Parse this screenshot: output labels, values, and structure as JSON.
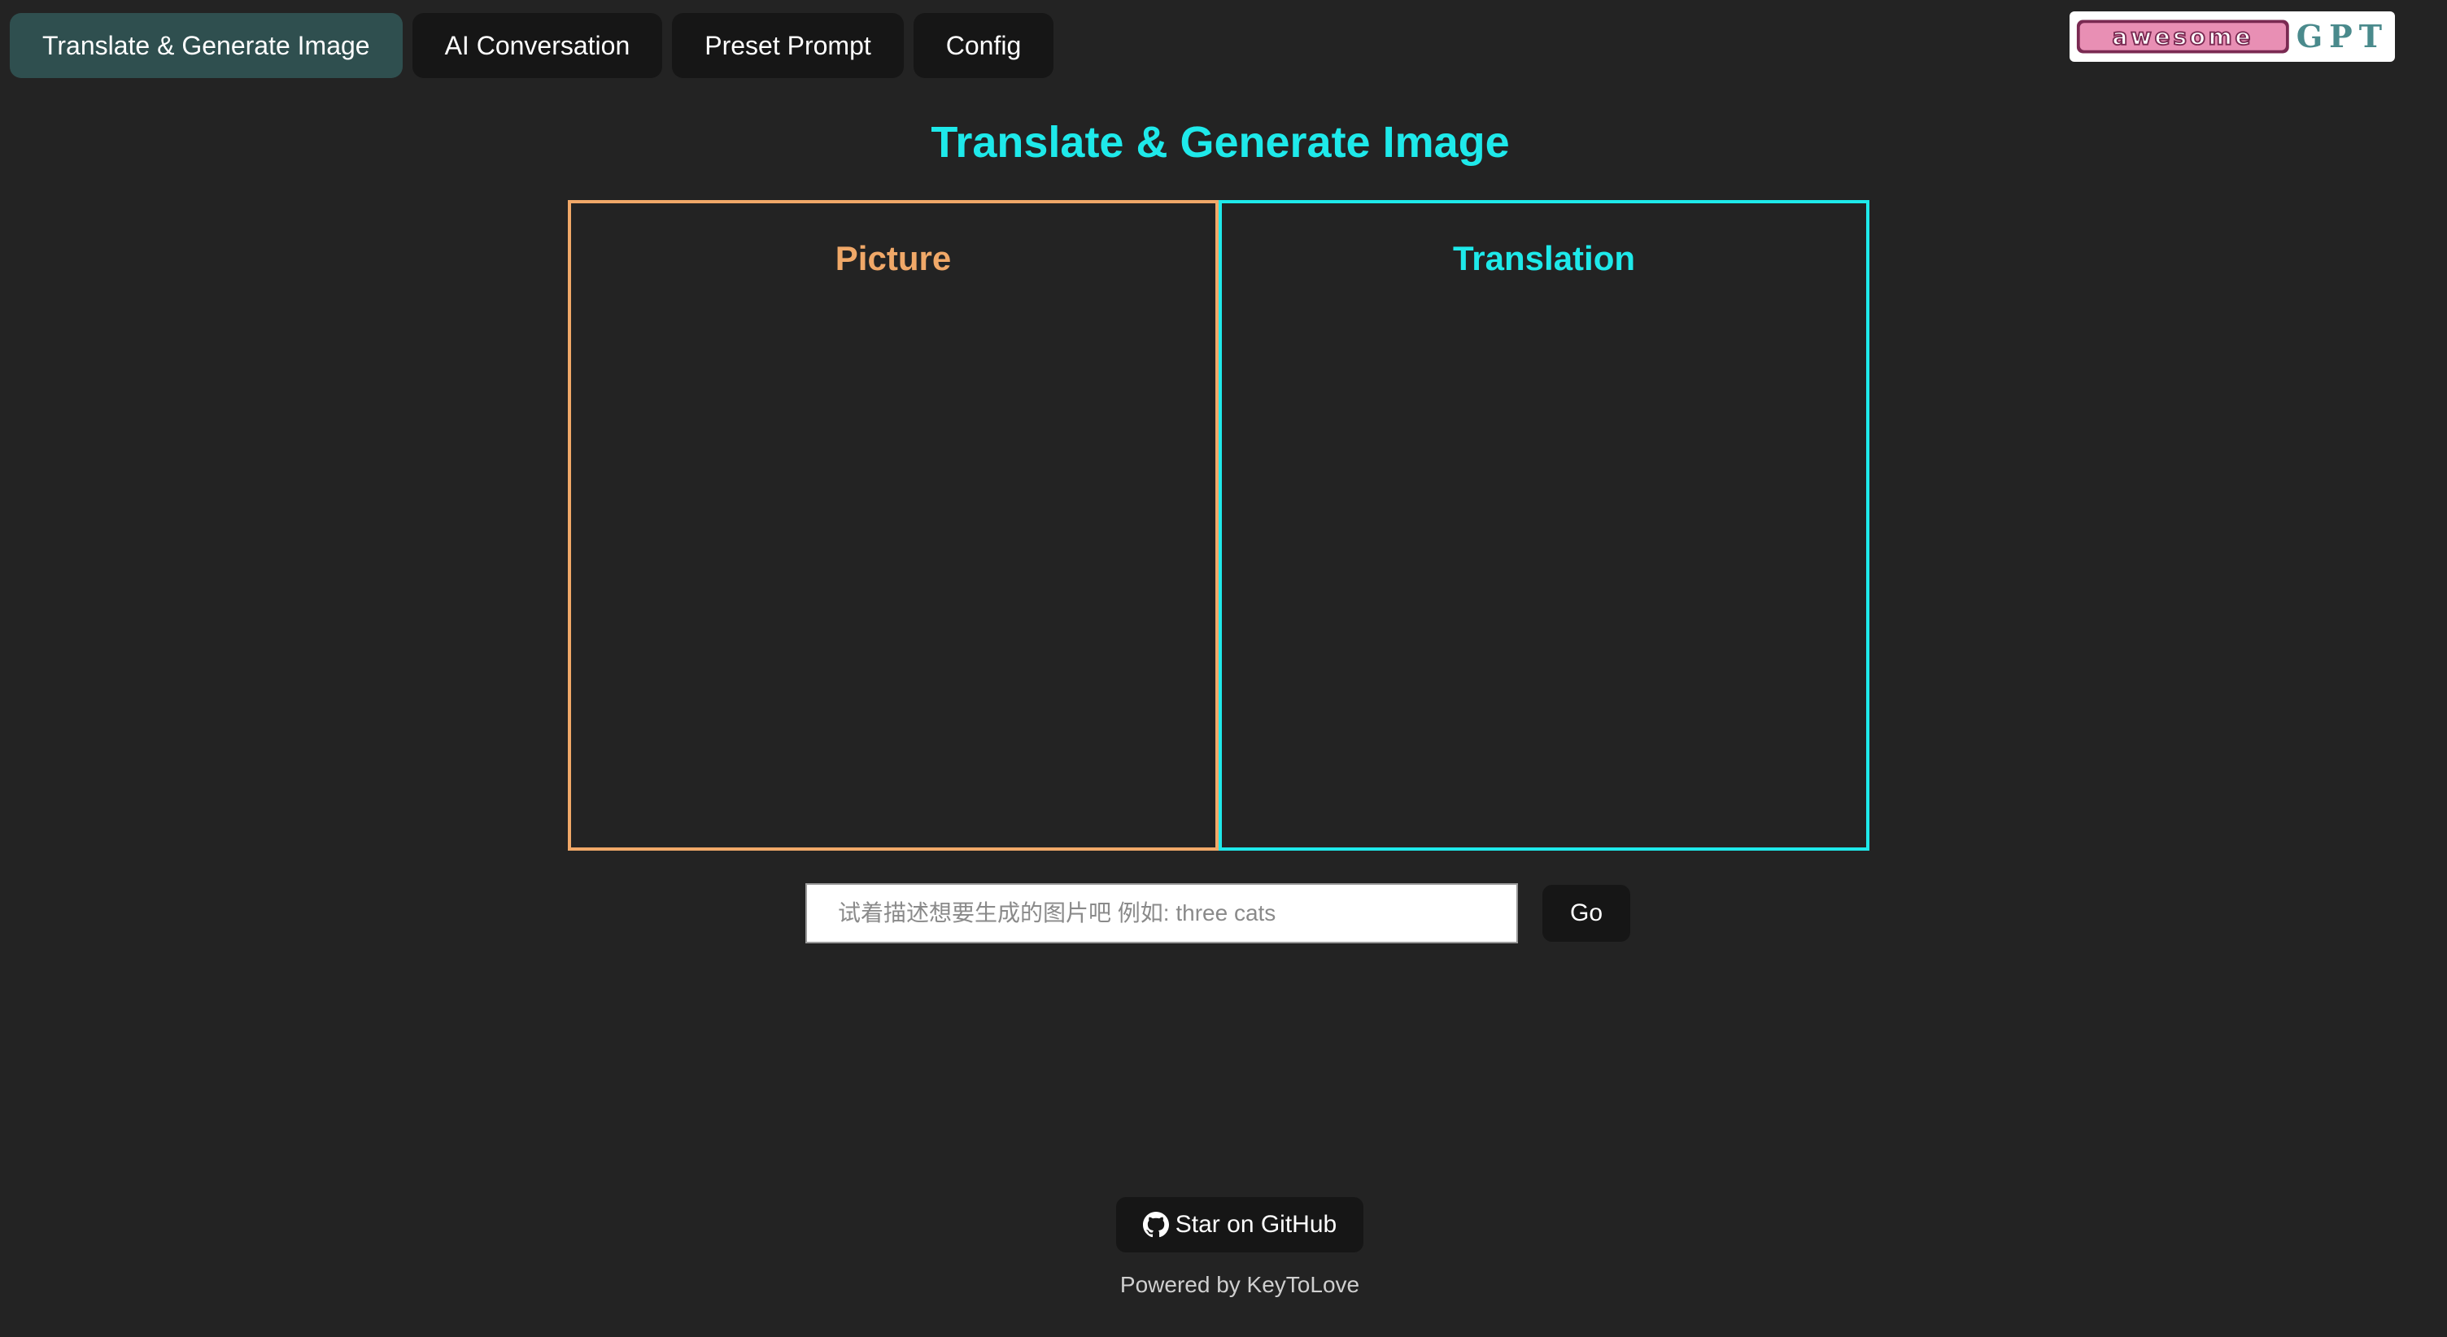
{
  "tabs": [
    {
      "label": "Translate & Generate Image",
      "active": true
    },
    {
      "label": "AI Conversation",
      "active": false
    },
    {
      "label": "Preset Prompt",
      "active": false
    },
    {
      "label": "Config",
      "active": false
    }
  ],
  "logo": {
    "word": "awesome",
    "suffix": "GPT"
  },
  "main": {
    "title": "Translate & Generate Image",
    "panels": {
      "picture": "Picture",
      "translation": "Translation"
    }
  },
  "prompt": {
    "placeholder": "试着描述想要生成的图片吧 例如: three cats",
    "value": "",
    "go_label": "Go"
  },
  "footer": {
    "github_label": "Star on GitHub",
    "powered_by": "Powered by KeyToLove"
  },
  "colors": {
    "background": "#232323",
    "active_tab": "#2f4f4f",
    "button": "#161616",
    "accent_cyan": "#1ee9ea",
    "accent_orange": "#f0a868"
  },
  "icons": {
    "github": "github-icon",
    "logo": "awesome-gpt-logo"
  }
}
